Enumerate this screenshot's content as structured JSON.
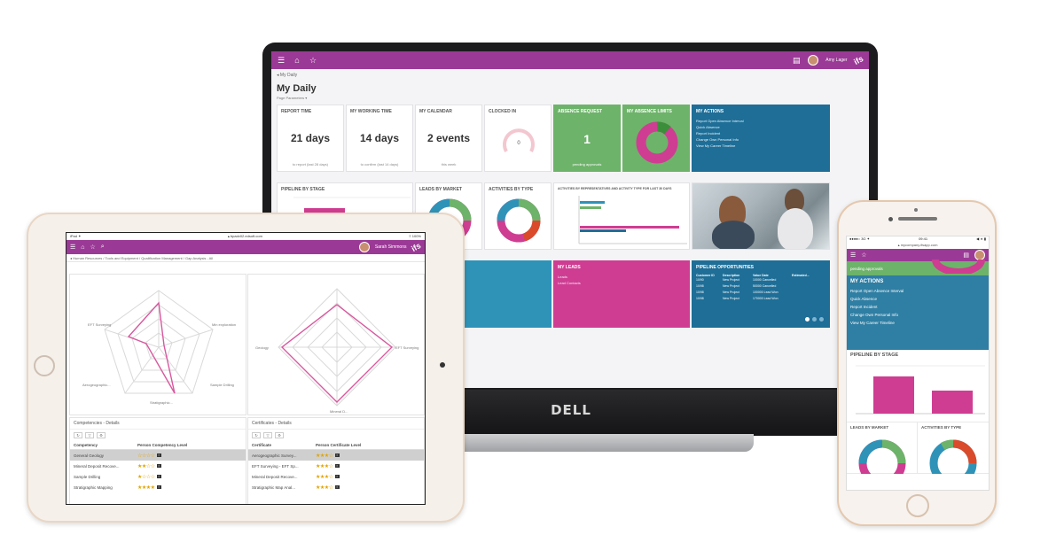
{
  "laptop": {
    "brand": "DELL",
    "user": "Amy Lager",
    "breadcrumb": "◂  My Daily",
    "page_title": "My Daily",
    "page_subtitle": "Page Parameters ▾",
    "tiles": {
      "report_time": {
        "title": "Report Time",
        "value": "21 days",
        "foot": "to report (last 28 days)"
      },
      "my_working_time": {
        "title": "My Working Time",
        "value": "14 days",
        "foot": "to confirm (last 14 days)"
      },
      "my_calendar": {
        "title": "My Calendar",
        "value": "2 events",
        "foot": "this week"
      },
      "clocked_in": {
        "title": "Clocked In",
        "gauge_value": "0"
      },
      "absence_request": {
        "title": "Absence Request",
        "value": "1",
        "foot": "pending approvals"
      },
      "my_absence_limits": {
        "title": "My Absence Limits"
      },
      "my_actions": {
        "title": "My Actions",
        "items": [
          "Report Open Absence Interval",
          "Quick Absence",
          "Report Incident",
          "Change Own Personal Info",
          "View My Career Timeline"
        ]
      },
      "pipeline_by_stage": {
        "title": "Pipeline By Stage"
      },
      "leads_by_market": {
        "title": "Leads By Market"
      },
      "activities_by_type": {
        "title": "Activities By Type"
      },
      "activities_by_rep": {
        "title": "Activities By Representatives And Activity Type For Last 30 Days"
      },
      "my_leads": {
        "title": "My Leads",
        "items": [
          "Leads",
          "Lead Contacts"
        ]
      },
      "pipeline_opportunities": {
        "title": "Pipeline Opportunities",
        "columns": [
          "Customer ID",
          "Description",
          "Value Date",
          "Estimated..."
        ],
        "rows": [
          [
            "10/90",
            "New Project",
            "10000 Cancelled",
            ""
          ],
          [
            "10/98",
            "New Project",
            "50000 Cancelled",
            ""
          ],
          [
            "10/98",
            "New Project",
            "100000 Lead Won",
            ""
          ],
          [
            "10/98",
            "New Project",
            "170000 Lead Won",
            ""
          ]
        ]
      }
    }
  },
  "tablet": {
    "status_left": "iPad ✦",
    "url": "▴ bpadv02.edsoft.com",
    "status_right": "≡ 100%",
    "user": "Sarah Simmons",
    "breadcrumb": "◂  Human Resources / Tools and Equipment / Qualification Management / Gap Analysis - All",
    "competencies": {
      "title": "Competencies - Details",
      "columns": [
        "Competency",
        "Person Competency Level"
      ],
      "rows": [
        {
          "name": "General Geology",
          "stars": "☆☆☆☆"
        },
        {
          "name": "Mineral Deposit Recove...",
          "stars": "★★☆☆"
        },
        {
          "name": "Sample Drilling",
          "stars": "★☆☆☆"
        },
        {
          "name": "Stratigraphic Mapping",
          "stars": "★★★★"
        }
      ]
    },
    "certificates": {
      "title": "Certificates - Details",
      "columns": [
        "Certificate",
        "Person Certificate Level"
      ],
      "rows": [
        {
          "name": "Aerogeographic Survey...",
          "stars": "★★★☆"
        },
        {
          "name": "EFT Surveying - EFT Sp...",
          "stars": "★★★☆"
        },
        {
          "name": "Mineral Deposit Recove...",
          "stars": "★★★☆"
        },
        {
          "name": "Stratigraphic Map Anal...",
          "stars": "★★★☆"
        }
      ]
    },
    "radar1_labels": [
      "EFT Surveying",
      "Min exploration",
      "Sample Drilling",
      "Stratigraphic...",
      "Aerogeographic..."
    ],
    "radar2_labels": [
      "EFT Surveying",
      "Geology",
      "Mineral D..."
    ]
  },
  "phone": {
    "status_left": "●●●●○ 3G ✦",
    "time": "09:41",
    "status_right": "◀ ∗ ▮",
    "url": "▴ mycompany.ifsapp.com",
    "pending": "pending approvals",
    "my_actions": {
      "title": "MY ACTIONS",
      "items": [
        "Report Open Absence Interval",
        "Quick Absence",
        "Report Incident",
        "Change Own Personal Info",
        "View My Career Timeline"
      ]
    },
    "pipeline_title": "PIPELINE BY STAGE",
    "leads_title": "LEADS BY MARKET",
    "activities_title": "ACTIVITIES BY TYPE"
  },
  "colors": {
    "brand_purple": "#9b3a96",
    "magenta": "#cf3d92",
    "green": "#6db36a",
    "blue": "#1e6e97",
    "teal": "#2f93b8"
  }
}
